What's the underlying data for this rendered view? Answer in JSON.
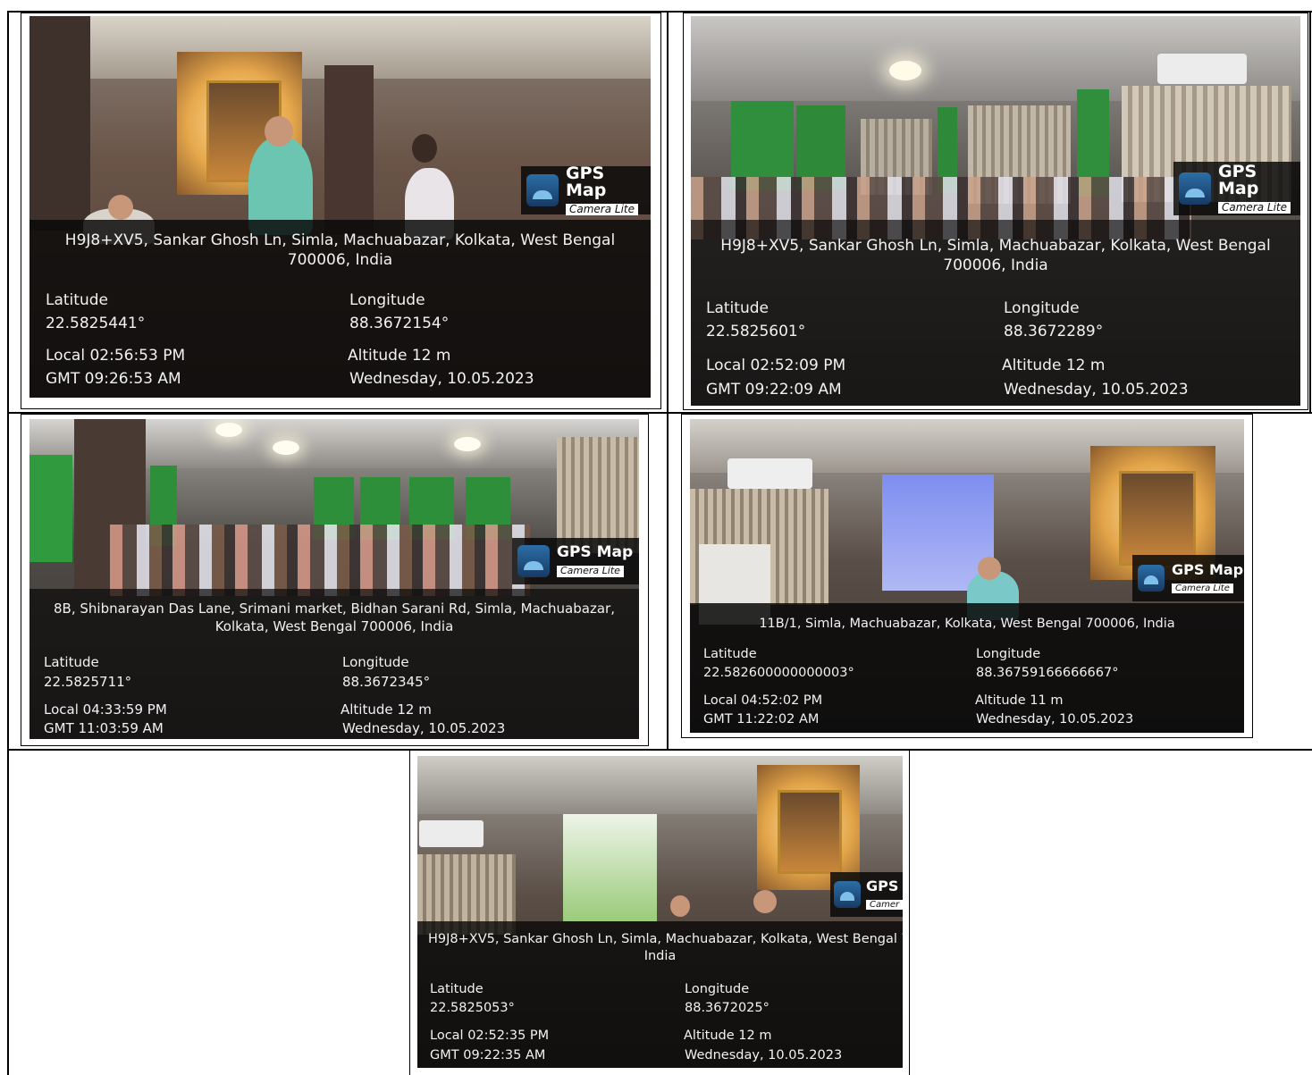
{
  "badge": {
    "title": "GPS Map",
    "subtitle": "Camera Lite"
  },
  "labels": {
    "latitude": "Latitude",
    "longitude": "Longitude"
  },
  "photos": [
    {
      "address": "H9J8+XV5, Sankar Ghosh Ln, Simla, Machuabazar, Kolkata, West Bengal 700006, India",
      "latitude": "22.5825441°",
      "longitude": "88.3672154°",
      "local": "Local 02:56:53 PM",
      "gmt": "GMT 09:26:53 AM",
      "altitude": "Altitude 12 m",
      "date": "Wednesday, 10.05.2023"
    },
    {
      "address": "H9J8+XV5, Sankar Ghosh Ln, Simla, Machuabazar, Kolkata, West Bengal 700006, India",
      "latitude": "22.5825601°",
      "longitude": "88.3672289°",
      "local": "Local 02:52:09 PM",
      "gmt": "GMT 09:22:09 AM",
      "altitude": "Altitude 12 m",
      "date": "Wednesday, 10.05.2023"
    },
    {
      "address": "8B, Shibnarayan Das Lane, Srimani market, Bidhan Sarani Rd, Simla, Machuabazar, Kolkata, West Bengal 700006, India",
      "latitude": "22.5825711°",
      "longitude": "88.3672345°",
      "local": "Local 04:33:59 PM",
      "gmt": "GMT 11:03:59 AM",
      "altitude": "Altitude 12 m",
      "date": "Wednesday, 10.05.2023"
    },
    {
      "address": "11B/1, Simla, Machuabazar, Kolkata, West Bengal 700006, India",
      "latitude": "22.582600000000003°",
      "longitude": "88.36759166666667°",
      "local": "Local 04:52:02 PM",
      "gmt": "GMT 11:22:02 AM",
      "altitude": "Altitude 11 m",
      "date": "Wednesday, 10.05.2023"
    },
    {
      "address": "H9J8+XV5, Sankar Ghosh Ln, Simla, Machuabazar, Kolkata, West Bengal 700",
      "address2": "India",
      "badge_title": "GPS",
      "badge_sub": "Camer",
      "latitude": "22.5825053°",
      "longitude": "88.3672025°",
      "local": "Local 02:52:35 PM",
      "gmt": "GMT 09:22:35 AM",
      "altitude": "Altitude 12 m",
      "date": "Wednesday, 10.05.2023"
    }
  ]
}
